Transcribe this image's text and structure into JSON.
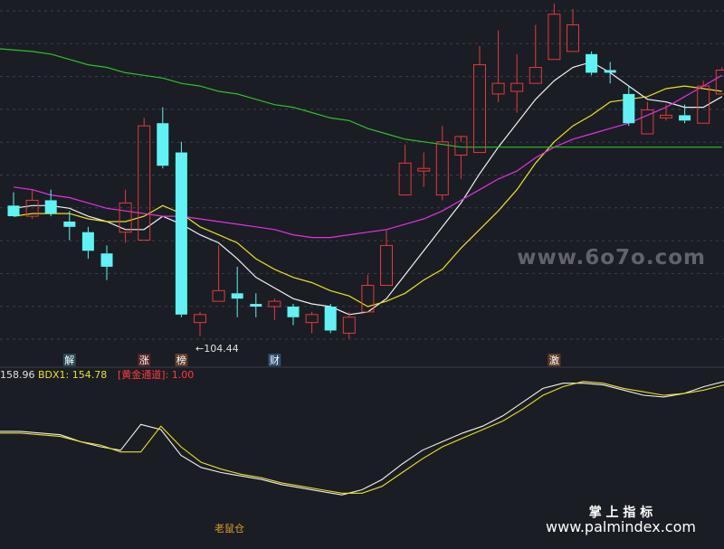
{
  "colors": {
    "background": "#1b1d24",
    "grid": "#3a3f4e",
    "up": "#e23b3b",
    "down": "#5ff3f3",
    "ma_white": "#f0f0f0",
    "ma_yellow": "#e8e21e",
    "ma_magenta": "#e033e0",
    "ma_green": "#2fbf2f",
    "indicator_white": "#f0f0f0",
    "indicator_yellow": "#e8e21e",
    "label_red": "#ff3b3b",
    "label_yellow": "#e8e21e",
    "badge_teal": "#35a8b0",
    "badge_red": "#c23030",
    "badge_orange": "#d97b2a",
    "badge_blue": "#4da3ff",
    "watermark": "#9a9aa8",
    "footer_text": "#ffffff",
    "mouse_label": "#e0a030"
  },
  "candle_panel": {
    "price_min": 100,
    "price_max": 230,
    "low_marker_label": "←104.44",
    "signal_badges": [
      {
        "text": "解",
        "candle": 3,
        "color": "#35a8b0"
      },
      {
        "text": "涨",
        "candle": 7,
        "color": "#c23030"
      },
      {
        "text": "榜",
        "candle": 9,
        "color": "#d97b2a"
      },
      {
        "text": "财",
        "candle": 14,
        "color": "#4da3ff"
      },
      {
        "text": "激",
        "candle": 29,
        "color": "#d97b2a"
      }
    ],
    "watermark": "www.6o7o.com"
  },
  "indicator_bar": {
    "value_left": "158.96",
    "bdx_label": "BDX1: 154.78",
    "channel_label": "[黄金通道]: 1.00"
  },
  "indicator_panel": {
    "range": [
      0,
      100
    ],
    "mouse_label": "老鼠仓"
  },
  "footer": {
    "brand_cn": "掌 上 指 标",
    "brand_url": "www.palmindex.com"
  },
  "chart_data": [
    {
      "type": "candlestick",
      "title": "",
      "ylim": [
        100,
        230
      ],
      "candles": [
        {
          "o": 154,
          "h": 159,
          "l": 150,
          "c": 150
        },
        {
          "o": 150,
          "h": 160,
          "l": 149,
          "c": 156
        },
        {
          "o": 156,
          "h": 160,
          "l": 150,
          "c": 151
        },
        {
          "o": 148,
          "h": 152,
          "l": 141,
          "c": 146
        },
        {
          "o": 144,
          "h": 146,
          "l": 134,
          "c": 137
        },
        {
          "o": 136,
          "h": 139,
          "l": 126,
          "c": 131
        },
        {
          "o": 144,
          "h": 160,
          "l": 140,
          "c": 155
        },
        {
          "o": 141,
          "h": 187,
          "l": 141,
          "c": 184
        },
        {
          "o": 185,
          "h": 191,
          "l": 168,
          "c": 169
        },
        {
          "o": 174,
          "h": 178,
          "l": 112,
          "c": 113
        },
        {
          "o": 110,
          "h": 114,
          "l": 105,
          "c": 113
        },
        {
          "o": 118,
          "h": 139,
          "l": 118,
          "c": 122
        },
        {
          "o": 121,
          "h": 131,
          "l": 112,
          "c": 119
        },
        {
          "o": 117,
          "h": 121,
          "l": 112,
          "c": 116
        },
        {
          "o": 116,
          "h": 119,
          "l": 111,
          "c": 118
        },
        {
          "o": 116,
          "h": 117,
          "l": 109,
          "c": 112
        },
        {
          "o": 110,
          "h": 114,
          "l": 106,
          "c": 113
        },
        {
          "o": 116,
          "h": 117,
          "l": 106,
          "c": 107
        },
        {
          "o": 106,
          "h": 114,
          "l": 104,
          "c": 112
        },
        {
          "o": 114,
          "h": 128,
          "l": 114,
          "c": 124
        },
        {
          "o": 124,
          "h": 145,
          "l": 124,
          "c": 139
        },
        {
          "o": 158,
          "h": 177,
          "l": 158,
          "c": 170
        },
        {
          "o": 167,
          "h": 174,
          "l": 161,
          "c": 168
        },
        {
          "o": 158,
          "h": 184,
          "l": 156,
          "c": 178
        },
        {
          "o": 173,
          "h": 178,
          "l": 164,
          "c": 180
        },
        {
          "o": 174,
          "h": 214,
          "l": 174,
          "c": 207
        },
        {
          "o": 196,
          "h": 220,
          "l": 193,
          "c": 200
        },
        {
          "o": 197,
          "h": 211,
          "l": 189,
          "c": 200
        },
        {
          "o": 200,
          "h": 222,
          "l": 200,
          "c": 206
        },
        {
          "o": 209,
          "h": 230,
          "l": 209,
          "c": 226
        },
        {
          "o": 212,
          "h": 228,
          "l": 212,
          "c": 222
        },
        {
          "o": 211,
          "h": 212,
          "l": 203,
          "c": 204
        },
        {
          "o": 205,
          "h": 208,
          "l": 200,
          "c": 204
        },
        {
          "o": 196,
          "h": 199,
          "l": 184,
          "c": 185
        },
        {
          "o": 181,
          "h": 193,
          "l": 181,
          "c": 190
        },
        {
          "o": 187,
          "h": 192,
          "l": 186,
          "c": 188
        },
        {
          "o": 188,
          "h": 192,
          "l": 185,
          "c": 186
        },
        {
          "o": 185,
          "h": 201,
          "l": 185,
          "c": 199
        },
        {
          "o": 196,
          "h": 206,
          "l": 196,
          "c": 205
        }
      ],
      "series": [
        {
          "values": [
            153,
            154,
            154,
            153,
            150,
            148,
            145,
            145,
            150,
            147,
            143,
            140,
            134,
            127,
            123,
            119,
            117,
            116,
            113,
            114,
            119,
            128,
            137,
            146,
            155,
            166,
            176,
            185,
            194,
            201,
            206,
            208,
            204,
            199,
            194,
            193,
            191,
            191,
            195
          ]
        },
        {
          "values": [
            150,
            151,
            151,
            151,
            149,
            148,
            148,
            150,
            154,
            151,
            146,
            143,
            140,
            134,
            130,
            127,
            125,
            122,
            120,
            116,
            118,
            121,
            126,
            130,
            138,
            145,
            152,
            160,
            170,
            178,
            184,
            188,
            193,
            194,
            195,
            198,
            199,
            198,
            197
          ]
        },
        {
          "values": [
            161,
            160,
            158,
            157,
            155,
            153,
            152,
            151,
            150,
            150,
            149,
            148,
            147,
            146,
            145,
            143,
            142,
            142,
            143,
            144,
            145,
            147,
            149,
            152,
            156,
            160,
            164,
            167,
            172,
            176,
            179,
            181,
            183,
            185,
            188,
            191,
            195,
            199,
            203
          ]
        },
        {
          "values": [
            213,
            212,
            211,
            209,
            207,
            206,
            204,
            203,
            202,
            200,
            199,
            197,
            196,
            194,
            192,
            191,
            189,
            187,
            186,
            183,
            181,
            179,
            178,
            177,
            176,
            176,
            176,
            176,
            176,
            176,
            176,
            176,
            176,
            176,
            176,
            176,
            176,
            176,
            176
          ]
        }
      ]
    },
    {
      "type": "line",
      "title": "",
      "ylim": [
        0,
        100
      ],
      "series": [
        {
          "values": [
            69,
            69,
            68,
            67,
            63,
            60,
            58,
            73,
            70,
            55,
            48,
            45,
            43,
            41,
            38,
            36,
            34,
            32,
            35,
            41,
            50,
            58,
            63,
            68,
            72,
            78,
            86,
            94,
            97,
            97,
            96,
            93,
            90,
            89,
            91,
            95,
            98
          ]
        },
        {
          "values": [
            68,
            68,
            67,
            66,
            63,
            61,
            57,
            57,
            72,
            60,
            51,
            47,
            44,
            42,
            39,
            37,
            35,
            33,
            33,
            37,
            45,
            53,
            60,
            65,
            70,
            75,
            82,
            90,
            95,
            98,
            97,
            94,
            92,
            90,
            91,
            93,
            96
          ]
        }
      ]
    }
  ]
}
